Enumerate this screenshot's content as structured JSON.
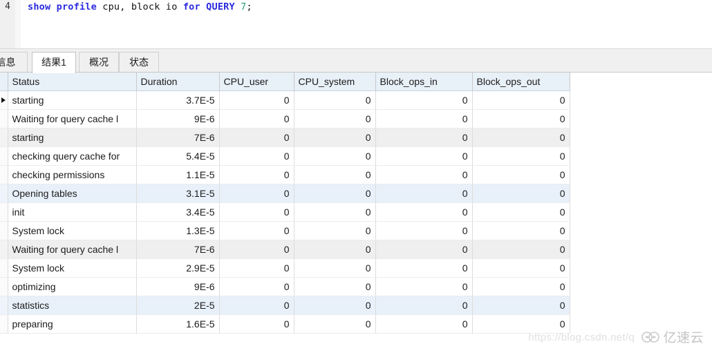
{
  "editor": {
    "line_number": "4",
    "tokens": [
      {
        "text": "show profile",
        "kind": "keyword"
      },
      {
        "text": " cpu, block io ",
        "kind": "plain"
      },
      {
        "text": "for QUERY",
        "kind": "keyword"
      },
      {
        "text": " ",
        "kind": "plain"
      },
      {
        "text": "7",
        "kind": "number"
      },
      {
        "text": ";",
        "kind": "plain"
      }
    ],
    "full_text": "show profile cpu, block io for QUERY 7;",
    "keyword_color": "#2a2ae0",
    "number_color": "#2f9e7e",
    "text_color": "#111111"
  },
  "tabs": [
    {
      "label": "信息",
      "active": false,
      "clipped": true
    },
    {
      "label": "结果1",
      "active": true,
      "clipped": false
    },
    {
      "label": "概况",
      "active": false,
      "clipped": false
    },
    {
      "label": "状态",
      "active": false,
      "clipped": false
    }
  ],
  "grid": {
    "columns": [
      "Status",
      "Duration",
      "CPU_user",
      "CPU_system",
      "Block_ops_in",
      "Block_ops_out"
    ],
    "header_bg": "#e8f0f8",
    "stripe_gray": "#efefef",
    "stripe_blue": "#e8f1fa",
    "current_row_index": 0,
    "rows": [
      {
        "status": "starting",
        "duration": "3.7E-5",
        "cpu_user": "0",
        "cpu_system": "0",
        "block_ops_in": "0",
        "block_ops_out": "0",
        "stripe": "none",
        "current": true
      },
      {
        "status": "Waiting for query cache l",
        "duration": "9E-6",
        "cpu_user": "0",
        "cpu_system": "0",
        "block_ops_in": "0",
        "block_ops_out": "0",
        "stripe": "none",
        "current": false
      },
      {
        "status": "starting",
        "duration": "7E-6",
        "cpu_user": "0",
        "cpu_system": "0",
        "block_ops_in": "0",
        "block_ops_out": "0",
        "stripe": "gray",
        "current": false
      },
      {
        "status": "checking query cache for",
        "duration": "5.4E-5",
        "cpu_user": "0",
        "cpu_system": "0",
        "block_ops_in": "0",
        "block_ops_out": "0",
        "stripe": "none",
        "current": false
      },
      {
        "status": "checking permissions",
        "duration": "1.1E-5",
        "cpu_user": "0",
        "cpu_system": "0",
        "block_ops_in": "0",
        "block_ops_out": "0",
        "stripe": "none",
        "current": false
      },
      {
        "status": "Opening tables",
        "duration": "3.1E-5",
        "cpu_user": "0",
        "cpu_system": "0",
        "block_ops_in": "0",
        "block_ops_out": "0",
        "stripe": "blue",
        "current": false
      },
      {
        "status": "init",
        "duration": "3.4E-5",
        "cpu_user": "0",
        "cpu_system": "0",
        "block_ops_in": "0",
        "block_ops_out": "0",
        "stripe": "none",
        "current": false
      },
      {
        "status": "System lock",
        "duration": "1.3E-5",
        "cpu_user": "0",
        "cpu_system": "0",
        "block_ops_in": "0",
        "block_ops_out": "0",
        "stripe": "none",
        "current": false
      },
      {
        "status": "Waiting for query cache l",
        "duration": "7E-6",
        "cpu_user": "0",
        "cpu_system": "0",
        "block_ops_in": "0",
        "block_ops_out": "0",
        "stripe": "gray",
        "current": false
      },
      {
        "status": "System lock",
        "duration": "2.9E-5",
        "cpu_user": "0",
        "cpu_system": "0",
        "block_ops_in": "0",
        "block_ops_out": "0",
        "stripe": "none",
        "current": false
      },
      {
        "status": "optimizing",
        "duration": "9E-6",
        "cpu_user": "0",
        "cpu_system": "0",
        "block_ops_in": "0",
        "block_ops_out": "0",
        "stripe": "none",
        "current": false
      },
      {
        "status": "statistics",
        "duration": "2E-5",
        "cpu_user": "0",
        "cpu_system": "0",
        "block_ops_in": "0",
        "block_ops_out": "0",
        "stripe": "blue",
        "current": false
      },
      {
        "status": "preparing",
        "duration": "1.6E-5",
        "cpu_user": "0",
        "cpu_system": "0",
        "block_ops_in": "0",
        "block_ops_out": "0",
        "stripe": "none",
        "current": false
      }
    ]
  },
  "watermarks": {
    "url": "https://blog.csdn.net/q",
    "brand": "亿速云"
  }
}
